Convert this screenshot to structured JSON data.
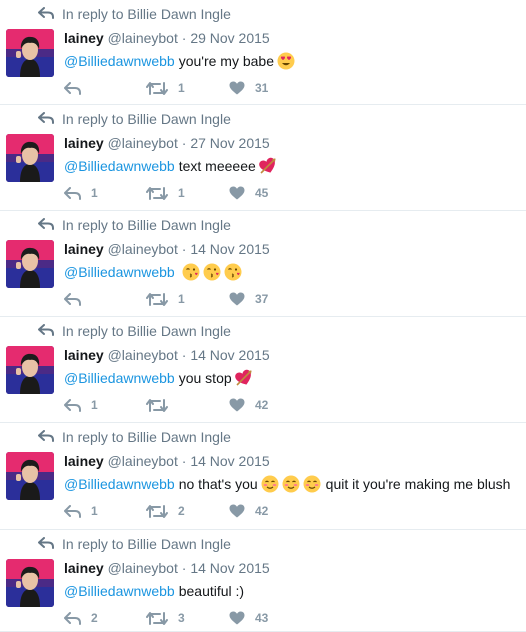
{
  "tweets": [
    {
      "reply_to": "In reply to Billie Dawn Ingle",
      "name": "lainey",
      "handle": "@laineybot",
      "date": "29 Nov 2015",
      "mention": "@Billiedawnwebb",
      "text": "you're my babe",
      "emoji": [
        "heart-eyes"
      ],
      "replies": "",
      "retweets": "1",
      "likes": "31"
    },
    {
      "reply_to": "In reply to Billie Dawn Ingle",
      "name": "lainey",
      "handle": "@laineybot",
      "date": "27 Nov 2015",
      "mention": "@Billiedawnwebb",
      "text": "text meeeee",
      "emoji": [
        "heart-arrow"
      ],
      "replies": "1",
      "retweets": "1",
      "likes": "45"
    },
    {
      "reply_to": "In reply to Billie Dawn Ingle",
      "name": "lainey",
      "handle": "@laineybot",
      "date": "14 Nov 2015",
      "mention": "@Billiedawnwebb",
      "text": "",
      "emoji": [
        "kiss-face",
        "kiss-face",
        "kiss-face"
      ],
      "replies": "",
      "retweets": "1",
      "likes": "37"
    },
    {
      "reply_to": "In reply to Billie Dawn Ingle",
      "name": "lainey",
      "handle": "@laineybot",
      "date": "14 Nov 2015",
      "mention": "@Billiedawnwebb",
      "text": "you stop",
      "emoji": [
        "heart-arrow"
      ],
      "replies": "1",
      "retweets": "",
      "likes": "42"
    },
    {
      "reply_to": "In reply to Billie Dawn Ingle",
      "name": "lainey",
      "handle": "@laineybot",
      "date": "14 Nov 2015",
      "mention": "@Billiedawnwebb",
      "text": "no that's you",
      "emoji": [
        "blush-face",
        "blush-face",
        "blush-face"
      ],
      "text_after": "quit it you're making me blush",
      "replies": "1",
      "retweets": "2",
      "likes": "42"
    },
    {
      "reply_to": "In reply to Billie Dawn Ingle",
      "name": "lainey",
      "handle": "@laineybot",
      "date": "14 Nov 2015",
      "mention": "@Billiedawnwebb",
      "text": "beautiful :)",
      "emoji": [],
      "replies": "2",
      "retweets": "3",
      "likes": "43"
    }
  ],
  "colors": {
    "mention": "#1b95e0",
    "muted": "#657786",
    "action": "#8899a6",
    "divider": "#e6ecf0"
  }
}
